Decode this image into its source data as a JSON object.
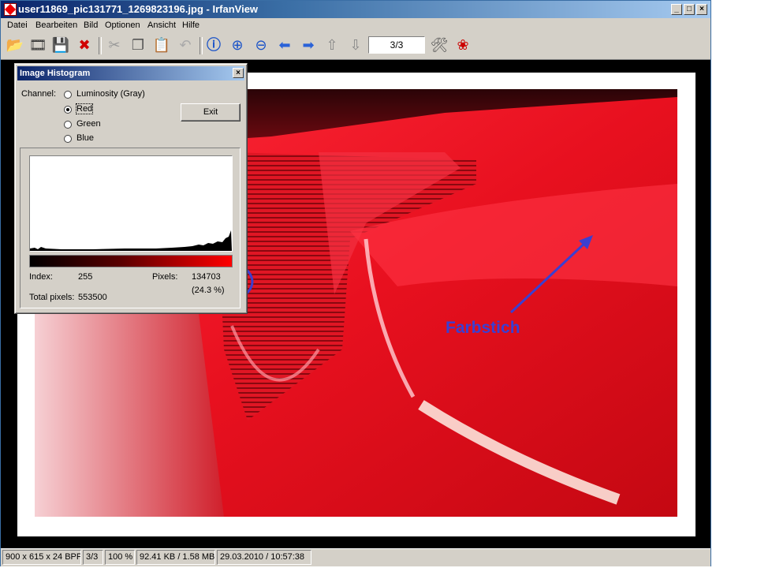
{
  "window": {
    "title": "user11869_pic131771_1269823196.jpg - IrfanView"
  },
  "menu": [
    "Datei",
    "Bearbeiten",
    "Bild",
    "Optionen",
    "Ansicht",
    "Hilfe"
  ],
  "toolbar": {
    "icons": [
      "open-folder-icon",
      "slideshow-icon",
      "save-icon",
      "delete-icon",
      "cut-icon",
      "copy-icon",
      "paste-icon",
      "undo-icon",
      "info-icon",
      "zoom-in-icon",
      "zoom-out-icon",
      "previous-arrow-icon",
      "next-arrow-icon",
      "first-page-icon",
      "last-page-icon",
      "settings-icon",
      "plugin-icon"
    ],
    "page_indicator": "3/3"
  },
  "histogram_dialog": {
    "title": "Image Histogram",
    "channel_label": "Channel:",
    "channels": [
      "Luminosity (Gray)",
      "Red",
      "Green",
      "Blue"
    ],
    "selected_channel": "Red",
    "exit_label": "Exit",
    "index_label": "Index:",
    "index_value": "255",
    "pixels_label": "Pixels:",
    "pixels_value": "134703",
    "pixels_percent": "(24.3 %)",
    "total_label": "Total pixels:",
    "total_value": "553500"
  },
  "annotation": {
    "text": "Farbstich",
    "color": "#3b3fd1"
  },
  "statusbar": [
    "900 x 615 x 24 BPP",
    "3/3",
    "100 %",
    "92.41 KB / 1.58 MB",
    "29.03.2010 / 10:57:38"
  ],
  "colors": {
    "accent_red": "#d40f1e",
    "titlebar": "#0a246a",
    "annotation_blue": "#3b3fd1"
  }
}
